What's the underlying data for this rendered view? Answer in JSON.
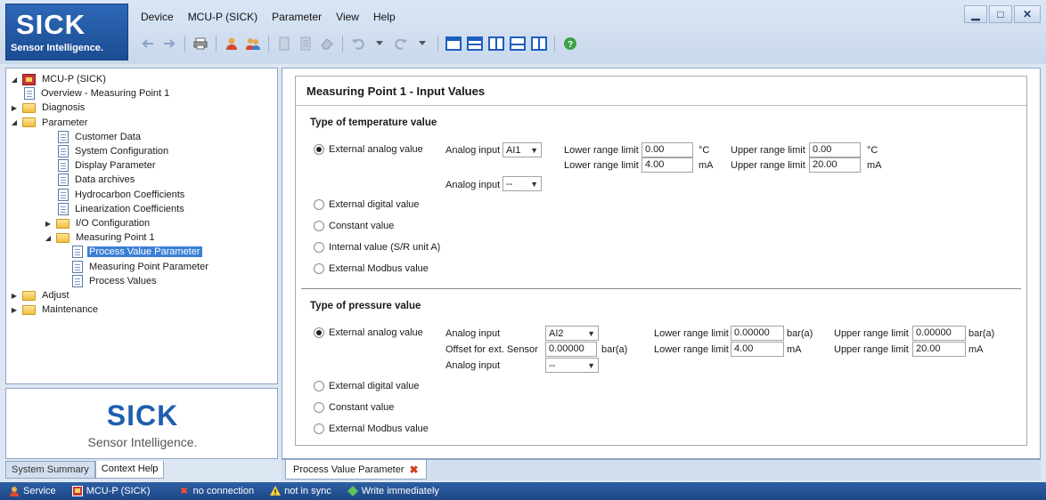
{
  "brand": {
    "logo": "SICK",
    "tagline": "Sensor Intelligence."
  },
  "menu": {
    "items": [
      "Device",
      "MCU-P (SICK)",
      "Parameter",
      "View",
      "Help"
    ]
  },
  "window": {
    "minimize": "▁",
    "maximize": "□",
    "close": "✕"
  },
  "toolbar": {
    "icons": [
      "back-arrow-icon",
      "forward-arrow-icon",
      "print-icon",
      "user-login-icon",
      "users-icon",
      "doc-icon",
      "doc-copy-icon",
      "eraser-icon",
      "undo-icon",
      "redo-icon",
      "layout-icons",
      "help-icon"
    ]
  },
  "tree": {
    "items": [
      {
        "label": "MCU-P (SICK)",
        "icon": "device-icon",
        "arrow": "◢"
      },
      {
        "label": "Overview - Measuring Point 1",
        "icon": "doc-icon"
      },
      {
        "label": "Diagnosis",
        "icon": "folder-icon",
        "arrow": "▶"
      },
      {
        "label": "Parameter",
        "icon": "folder-icon",
        "arrow": "◢"
      },
      {
        "label": "Customer Data",
        "icon": "doc-icon"
      },
      {
        "label": "System Configuration",
        "icon": "doc-icon"
      },
      {
        "label": "Display Parameter",
        "icon": "doc-icon"
      },
      {
        "label": "Data archives",
        "icon": "doc-icon"
      },
      {
        "label": "Hydrocarbon Coefficients",
        "icon": "doc-icon"
      },
      {
        "label": "Linearization Coefficients",
        "icon": "doc-icon"
      },
      {
        "label": "I/O Configuration",
        "icon": "folder-icon",
        "arrow": "▶"
      },
      {
        "label": "Measuring Point 1",
        "icon": "folder-icon",
        "arrow": "◢"
      },
      {
        "label": "Process Value Parameter",
        "icon": "doc-icon",
        "selected": true
      },
      {
        "label": "Measuring Point Parameter",
        "icon": "doc-icon"
      },
      {
        "label": "Process Values",
        "icon": "doc-icon"
      },
      {
        "label": "Adjust",
        "icon": "folder-icon",
        "arrow": "▶"
      },
      {
        "label": "Maintenance",
        "icon": "folder-icon",
        "arrow": "▶"
      }
    ]
  },
  "left_panel": {
    "logo": "SICK",
    "tagline": "Sensor Intelligence.",
    "tabs": [
      "System Summary",
      "Context Help"
    ],
    "active_tab": "Context Help"
  },
  "content": {
    "title": "Measuring Point 1 - Input Values",
    "temperature": {
      "section_title": "Type of temperature value",
      "options": [
        "External analog value",
        "External digital value",
        "Constant value",
        "Internal value (S/R unit A)",
        "External Modbus value"
      ],
      "selected": "External analog value",
      "analog_input_label": "Analog input",
      "analog_input_value": "AI1",
      "analog_input2_label": "Analog input",
      "analog_input2_value": "--",
      "lower_range_label": "Lower range limit",
      "upper_range_label": "Upper range limit",
      "lower1": "0.00",
      "lower1_unit": "°C",
      "upper1": "0.00",
      "upper1_unit": "°C",
      "lower2": "4.00",
      "lower2_unit": "mA",
      "upper2": "20.00",
      "upper2_unit": "mA"
    },
    "pressure": {
      "section_title": "Type of pressure value",
      "options": [
        "External analog value",
        "External digital value",
        "Constant value",
        "External Modbus value"
      ],
      "selected": "External analog value",
      "analog_input_label": "Analog input",
      "analog_input_value": "AI2",
      "offset_label": "Offset for ext. Sensor",
      "offset_value": "0.00000",
      "offset_unit": "bar(a)",
      "analog_input2_label": "Analog input",
      "analog_input2_value": "--",
      "lower_range_label": "Lower range limit",
      "upper_range_label": "Upper range limit",
      "lower1": "0.00000",
      "lower1_unit": "bar(a)",
      "upper1": "0.00000",
      "upper1_unit": "bar(a)",
      "lower2": "4.00",
      "lower2_unit": "mA",
      "upper2": "20.00",
      "upper2_unit": "mA"
    }
  },
  "doc_tab": {
    "label": "Process Value Parameter"
  },
  "status": {
    "service": "Service",
    "device": "MCU-P (SICK)",
    "connection": "no connection",
    "sync": "not in sync",
    "write_mode": "Write immediately"
  },
  "colors": {
    "brand_blue": "#1f5fad",
    "selection": "#3a7fd5",
    "status_bar": "#1d4787"
  }
}
